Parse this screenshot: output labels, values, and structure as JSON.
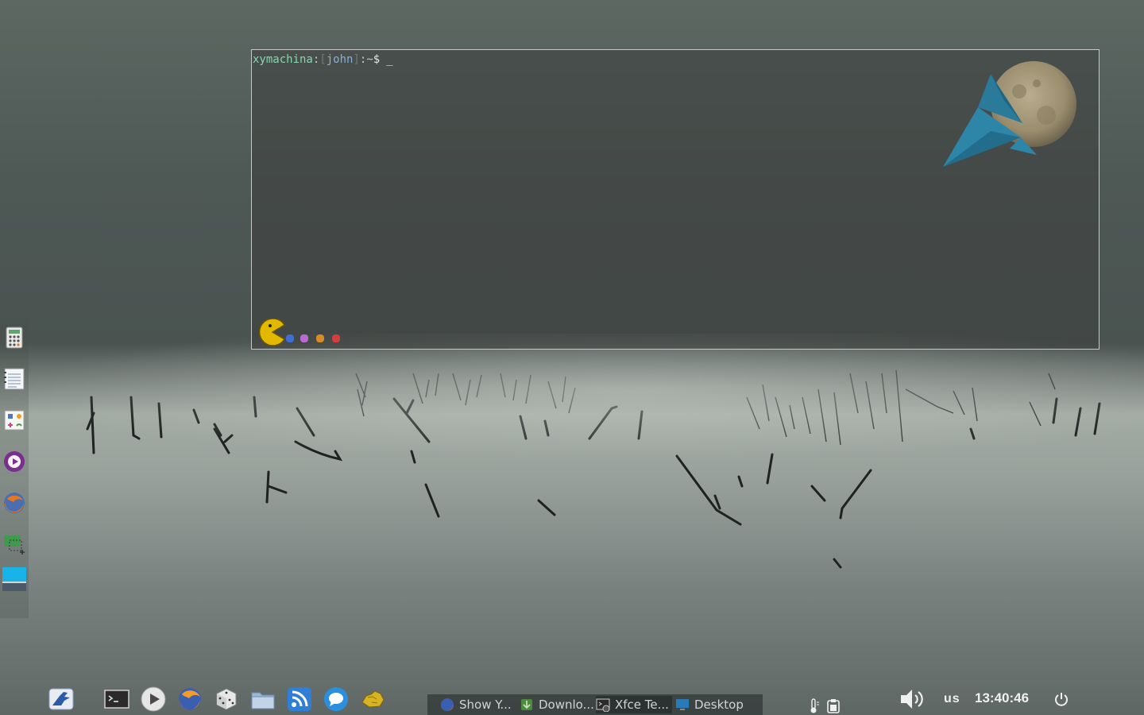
{
  "terminal": {
    "host": "xymachina",
    "colon": ":",
    "bracket_open": "[",
    "user": "john",
    "bracket_close": "]",
    "path": ":~",
    "dollar": "$",
    "cursor": "_"
  },
  "left_dock": {
    "items": [
      {
        "name": "calculator-icon"
      },
      {
        "name": "text-editor-icon"
      },
      {
        "name": "character-map-icon"
      },
      {
        "name": "media-player-icon"
      },
      {
        "name": "firefox-icon"
      },
      {
        "name": "screenshot-icon"
      },
      {
        "name": "desktop-icon"
      }
    ]
  },
  "bottom_panel": {
    "launchers": [
      {
        "name": "xfce-menu-icon"
      },
      {
        "name": "terminal-icon"
      },
      {
        "name": "media-play-icon"
      },
      {
        "name": "firefox-icon"
      },
      {
        "name": "dice-game-icon"
      },
      {
        "name": "file-manager-icon"
      },
      {
        "name": "rss-reader-icon"
      },
      {
        "name": "chat-icon"
      },
      {
        "name": "gold-nugget-icon"
      }
    ],
    "tasks": [
      {
        "label": "Show Y...",
        "icon": "firefox-icon"
      },
      {
        "label": "Downlo...",
        "icon": "downloads-icon"
      },
      {
        "label": "Xfce Te...",
        "icon": "terminal-icon"
      },
      {
        "label": "Desktop",
        "icon": "desktop-icon"
      }
    ],
    "tray": {
      "keyboard_layout": "us",
      "clock": "13:40:46"
    }
  },
  "colors": {
    "host": "#87d7af",
    "user": "#87afd7",
    "terminal_border": "#c7c7c7"
  }
}
